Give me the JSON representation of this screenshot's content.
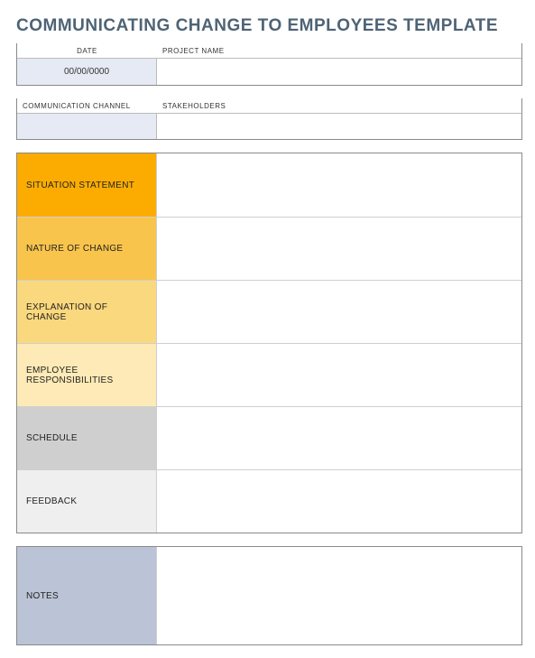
{
  "title": "COMMUNICATING CHANGE TO EMPLOYEES TEMPLATE",
  "meta": {
    "date_label": "DATE",
    "date_value": "00/00/0000",
    "project_label": "PROJECT NAME",
    "project_value": "",
    "channel_label": "COMMUNICATION CHANNEL",
    "channel_value": "",
    "stakeholders_label": "STAKEHOLDERS",
    "stakeholders_value": ""
  },
  "sections": {
    "situation": {
      "label": "SITUATION STATEMENT",
      "value": ""
    },
    "nature": {
      "label": "NATURE OF CHANGE",
      "value": ""
    },
    "explain": {
      "label": "EXPLANATION OF CHANGE",
      "value": ""
    },
    "resp": {
      "label": "EMPLOYEE RESPONSIBILITIES",
      "value": ""
    },
    "schedule": {
      "label": "SCHEDULE",
      "value": ""
    },
    "feedback": {
      "label": "FEEDBACK",
      "value": ""
    }
  },
  "notes": {
    "label": "NOTES",
    "value": ""
  }
}
